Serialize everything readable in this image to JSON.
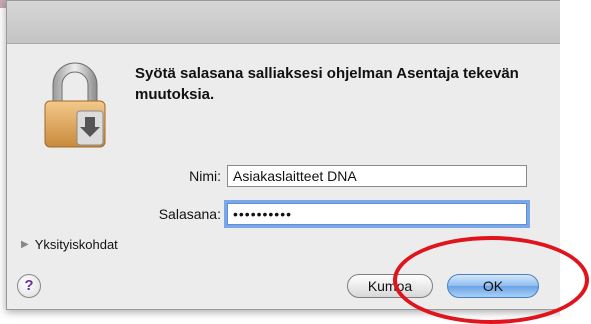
{
  "dialog": {
    "message": "Syötä salasana salliaksesi ohjelman Asentaja tekevän muutoksia.",
    "name_label": "Nimi:",
    "name_value": "Asiakaslaitteet DNA",
    "password_label": "Salasana:",
    "password_value": "••••••••••",
    "details_label": "Yksityiskohdat",
    "help_label": "?",
    "cancel_label": "Kumoa",
    "ok_label": "OK"
  },
  "colors": {
    "annotation_circle": "#e0141c",
    "default_button": "#6aa3e6"
  },
  "icons": {
    "lock": "lock-icon",
    "details": "disclosure-triangle-icon",
    "help": "help-icon"
  }
}
